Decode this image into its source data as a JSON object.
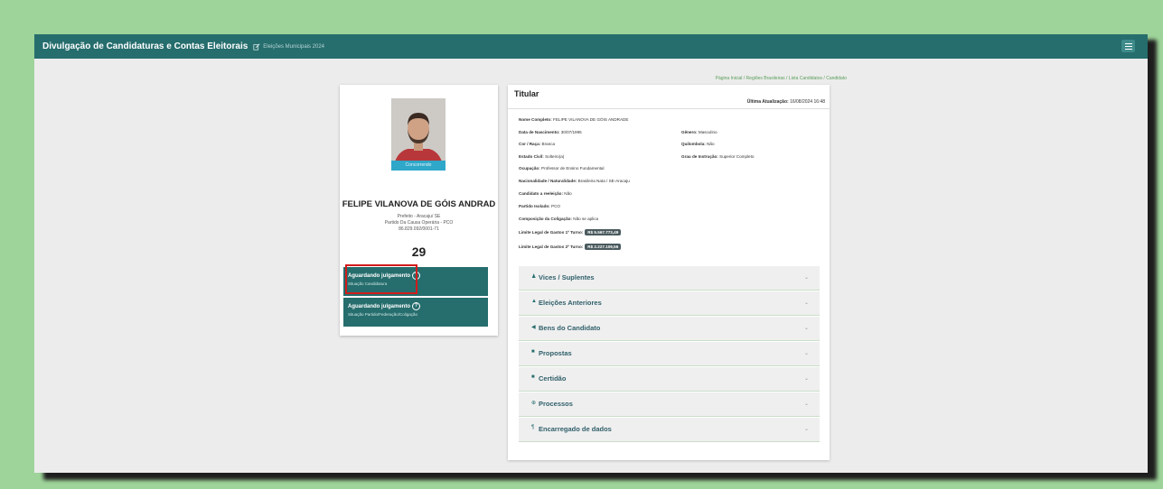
{
  "header": {
    "title": "Divulgação de Candidaturas e Contas Eleitorais",
    "election_label": "Eleições Municipais 2024"
  },
  "breadcrumb": "Página Inicial / Regiões Brasileiras / Lista Candidatos / Candidato",
  "candidate": {
    "photo_status": "Concorrendo",
    "name": "FELIPE VILANOVA DE GÓIS ANDRAD",
    "office": "Prefeito - Aracaju/ SE",
    "party": "Partido Da Causa Operária - PCO",
    "cnpj": "86.829.092/0001-71",
    "number": "29",
    "status1": {
      "main": "Aguardando julgamento",
      "sub": "Situação Candidatura"
    },
    "status2": {
      "main": "Aguardando julgamento",
      "sub": "Situação Partido/Federação/Coligação"
    }
  },
  "titular": {
    "heading": "Titular",
    "last_update_label": "Última Atualização:",
    "last_update_value": "16/08/2024 16:48",
    "fields": {
      "nome_label": "Nome Completo:",
      "nome_value": "FELIPE VILANOVA DE GÓIS ANDRADE",
      "nasc_label": "Data de Nascimento:",
      "nasc_value": "30/07/1995",
      "cor_label": "Cor / Raça:",
      "cor_value": "Branca",
      "civil_label": "Estado Civil:",
      "civil_value": "Solteiro(a)",
      "ocup_label": "Ocupação:",
      "ocup_value": "Professor de Ensino Fundamental",
      "nac_label": "Nacionalidade / Naturalidade:",
      "nac_value": "Brasileira Nata / SE-Aracaju",
      "reel_label": "Candidato a reeleição:",
      "reel_value": "Não",
      "partido_label": "Partido Isolado:",
      "partido_value": "PCO",
      "coli_label": "Composição da Coligação:",
      "coli_value": "Não se aplica",
      "lim1_label": "Limite Legal de Gastos 1º Turno:",
      "lim1_value": "R$ 5.567.773,49",
      "lim2_label": "Limite Legal de Gastos 2º Turno:",
      "lim2_value": "R$ 2.227.109,56",
      "genero_label": "Gênero:",
      "genero_value": "Masculino",
      "quil_label": "Quilombola:",
      "quil_value": "Não",
      "grau_label": "Grau de Instrução:",
      "grau_value": "Superior Completo"
    }
  },
  "accordion": [
    {
      "icon": "person-icon",
      "label": "Vices / Suplentes"
    },
    {
      "icon": "chart-icon",
      "label": "Eleições Anteriores"
    },
    {
      "icon": "tag-icon",
      "label": "Bens do Candidato"
    },
    {
      "icon": "file-icon",
      "label": "Propostas"
    },
    {
      "icon": "file-icon",
      "label": "Certidão"
    },
    {
      "icon": "gavel-icon",
      "label": "Processos"
    },
    {
      "icon": "id-icon",
      "label": "Encarregado de dados"
    }
  ],
  "colors": {
    "primary": "#266d6d",
    "background_green": "#9ed49a",
    "highlight_red": "#d21b1b",
    "photo_tag": "#2ea7c9"
  }
}
